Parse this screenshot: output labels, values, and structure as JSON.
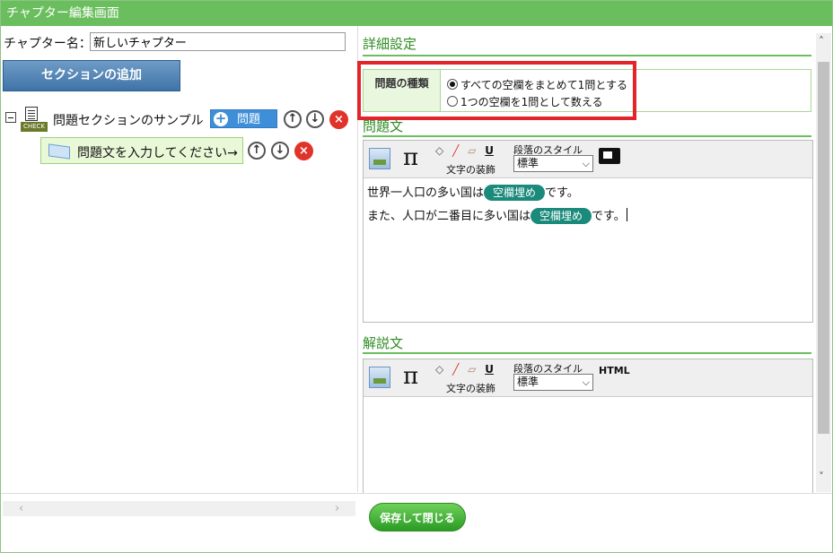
{
  "window": {
    "title": "チャプター編集画面"
  },
  "left": {
    "chapter_name_label": "チャプター名：",
    "chapter_name_value": "新しいチャプター",
    "add_section_label": "セクションの追加",
    "tree": {
      "section_icon_label": "CHECK",
      "section_label": "問題セクションのサンプル",
      "question_badge": "問題",
      "question_node_label": "問題文を入力してください→"
    }
  },
  "right": {
    "detail_heading": "詳細設定",
    "question_type_label": "問題の種類",
    "radio_options": [
      {
        "label": "すべての空欄をまとめて1問とする",
        "checked": true
      },
      {
        "label": "1つの空欄を1問として数える",
        "checked": false
      }
    ],
    "question_heading": "問題文",
    "explanation_heading": "解説文",
    "toolbar": {
      "decoration_label": "文字の装飾",
      "paragraph_style_label": "段落のスタイル",
      "paragraph_style_value": "標準",
      "html_label": "HTML"
    },
    "question_body": {
      "line1_before": "世界一人口の多い国は",
      "line1_blank": "空欄埋め",
      "line1_after": "です。",
      "line2_before": "また、人口が二番目に多い国は",
      "line2_blank": "空欄埋め",
      "line2_after": "です。"
    }
  },
  "footer": {
    "save_close_label": "保存して閉じる"
  },
  "icons": {
    "minus": "−",
    "plus": "+",
    "up": "↑",
    "down": "↓",
    "delete": "×",
    "pi": "π",
    "chevron_left": "‹",
    "chevron_right": "›",
    "chevron_up": "˄",
    "chevron_down": "˅",
    "underline": "U",
    "dropdown": "⌵"
  },
  "colors": {
    "title_bar": "#6bbe5e",
    "heading": "#2e8b22",
    "blank_pill": "#1a8a7a",
    "highlight": "#e3242b",
    "save": "#2a9b24"
  }
}
